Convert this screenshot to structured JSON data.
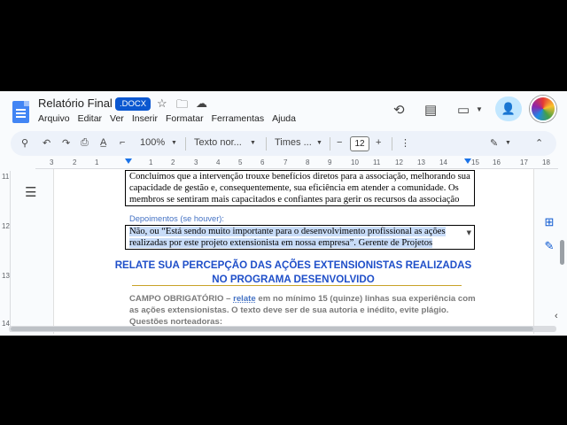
{
  "header": {
    "doc_title": "Relatório Final",
    "badge": ".DOCX",
    "menu": [
      "Arquivo",
      "Editar",
      "Ver",
      "Inserir",
      "Formatar",
      "Ferramentas",
      "Ajuda"
    ]
  },
  "toolbar": {
    "zoom": "100%",
    "style": "Texto nor...",
    "font": "Times ...",
    "font_size": "12",
    "minus": "−",
    "plus": "+"
  },
  "ruler": {
    "numbers": [
      "3",
      "2",
      "1",
      "1",
      "2",
      "3",
      "4",
      "5",
      "6",
      "7",
      "8",
      "9",
      "10",
      "11",
      "12",
      "13",
      "14",
      "15",
      "16",
      "17",
      "18"
    ],
    "vnumbers": [
      "11",
      "12",
      "13",
      "14"
    ]
  },
  "document": {
    "box1_text": "Concluímos que a intervenção trouxe benefícios diretos para a associação, melhorando sua capacidade de gestão e, consequentemente, sua eficiência em atender a comunidade. Os membros se sentiram mais capacitados e confiantes para gerir os recursos da associação",
    "depoimentos_label": "Depoimentos (se houver):",
    "box2_text": "Não,   ou   “Está sendo muito importante para o desenvolvimento profissional  as ações realizadas por este projeto extensionista em nossa empresa”. Gerente de Projetos",
    "heading_line1": "RELATE SUA PERCEPÇÃO DAS AÇÕES EXTENSIONISTAS REALIZADAS",
    "heading_line2": "NO PROGRAMA DESENVOLVIDO",
    "campo_part1": "CAMPO OBRIGATÓRIO – ",
    "campo_relate": "relate",
    "campo_part2": " em no mínimo 15 (quinze) linhas sua experiência com as ações extensionistas. O texto deve ser de sua autoria e inédito, evite plágio.",
    "questoes": "Questões norteadoras:"
  },
  "colors": {
    "accent": "#0b57d0",
    "heading": "#1f4fc9",
    "label": "#4472c4",
    "selection": "#c8dcf8"
  },
  "icons": [
    "history-icon",
    "comment-icon",
    "video-icon",
    "share-icon",
    "search-icon",
    "undo-icon",
    "redo-icon",
    "print-icon",
    "spellcheck-icon",
    "paint-format-icon",
    "more-icon",
    "pencil-icon",
    "chevron-up-icon",
    "outline-icon",
    "add-comment-icon",
    "suggest-edit-icon"
  ]
}
